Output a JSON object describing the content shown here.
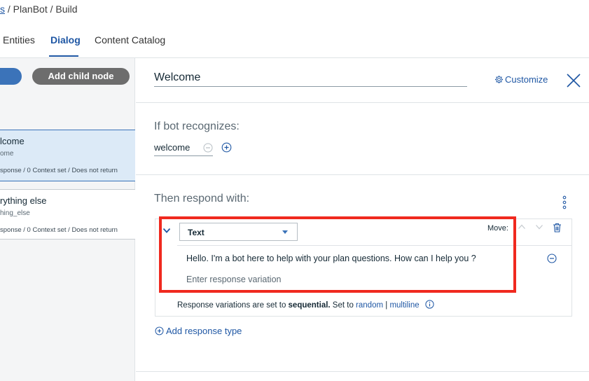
{
  "breadcrumb": {
    "prefix": "s",
    "rest": " / PlanBot / Build"
  },
  "tabs": [
    {
      "label": "Entities"
    },
    {
      "label": "Dialog",
      "active": true
    },
    {
      "label": "Content Catalog"
    }
  ],
  "left": {
    "add_child_label": "Add child node",
    "nodes": [
      {
        "title": "lcome",
        "condition": "ome",
        "meta": "sponse / 0 Context set / Does not return",
        "selected": true
      },
      {
        "title": "rything else",
        "condition": "hing_else",
        "meta": "sponse / 0 Context set / Does not return",
        "selected": false
      }
    ]
  },
  "editor": {
    "node_name": "Welcome",
    "customize_label": "Customize",
    "recognize_label": "If bot recognizes:",
    "intent_value": "welcome",
    "respond_label": "Then respond with:",
    "response_type": "Text",
    "move_label": "Move:",
    "variations": [
      "Hello. I'm a bot here to help with your plan questions. How can I help you ?"
    ],
    "variation_placeholder": "Enter response variation",
    "sequential": {
      "prefix": "Response variations are set to ",
      "mode": "sequential.",
      "middle": " Set to ",
      "option_random": "random",
      "sep": " | ",
      "option_multiline": "multiline"
    },
    "add_response_label": "Add response type"
  },
  "colors": {
    "accent": "#1f57a4",
    "highlight": "#f0291f",
    "selected_node": "#dceaf7",
    "child_button": "#6d6d6d"
  }
}
